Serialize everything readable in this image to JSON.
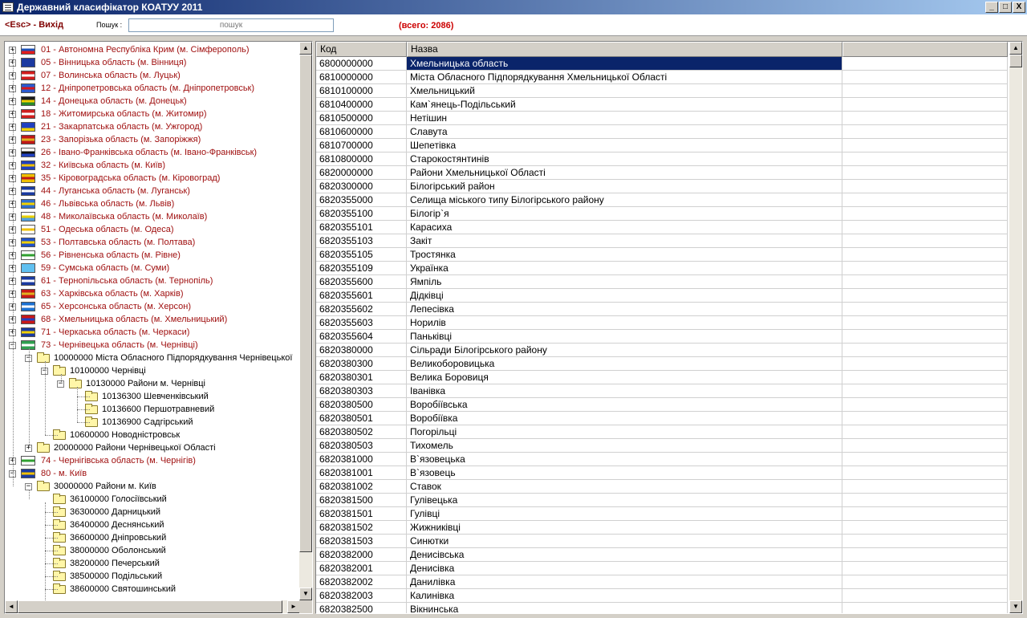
{
  "window": {
    "title": "Державний класифікатор КОАТУУ 2011",
    "btn_min": "_",
    "btn_max": "□",
    "btn_close": "X"
  },
  "toolbar": {
    "esc_key": "<Esc>",
    "esc_label": " - Вихід",
    "search_label": "Пошук :",
    "search_placeholder": "пошук",
    "total": "(всего: 2086)"
  },
  "tree": {
    "regions": [
      {
        "text": "01 - Автономна Республіка Крим (м. Сімферополь)",
        "flag": [
          "#ffffff",
          "#1e4fb4",
          "#e21c1c"
        ]
      },
      {
        "text": "05 - Вінницька область (м. Вінниця)",
        "flag": [
          "#1c3aa0",
          "#1c3aa0",
          "#1c3aa0"
        ]
      },
      {
        "text": "07 - Волинська область (м. Луцьк)",
        "flag": [
          "#d01c1c",
          "#ffffff",
          "#d01c1c"
        ]
      },
      {
        "text": "12 - Дніпропетровська область (м. Дніпропетровськ)",
        "flag": [
          "#2a5ad0",
          "#d81818",
          "#2a5ad0"
        ]
      },
      {
        "text": "14 - Донецька область (м. Донецьк)",
        "flag": [
          "#1a1a1a",
          "#f0d000",
          "#2a8a2a"
        ]
      },
      {
        "text": "18 - Житомирська область (м. Житомир)",
        "flag": [
          "#d02020",
          "#ffffff",
          "#d02020"
        ]
      },
      {
        "text": "21 - Закарпатська область (м. Ужгород)",
        "flag": [
          "#2040c0",
          "#2040c0",
          "#f0d000"
        ]
      },
      {
        "text": "23 - Запорізька область (м. Запоріжжя)",
        "flag": [
          "#c01818",
          "#e0b020",
          "#c01818"
        ]
      },
      {
        "text": "26 - Івано-Франківська область (м. Івано-Франківськ)",
        "flag": [
          "#ffffff",
          "#101010",
          "#2040c0"
        ]
      },
      {
        "text": "32 - Київська область (м. Київ)",
        "flag": [
          "#2040c0",
          "#f0c000",
          "#2040c0"
        ]
      },
      {
        "text": "35 - Кіровоградська область (м. Кіровоград)",
        "flag": [
          "#f0c000",
          "#c01818",
          "#f0c000"
        ]
      },
      {
        "text": "44 - Луганська область (м. Луганськ)",
        "flag": [
          "#1a3aa0",
          "#ffffff",
          "#1a3aa0"
        ]
      },
      {
        "text": "46 - Львівська область (м. Львів)",
        "flag": [
          "#3070d0",
          "#f0d000",
          "#3070d0"
        ]
      },
      {
        "text": "48 - Миколаївська область (м. Миколаїв)",
        "flag": [
          "#ffffff",
          "#e8d000",
          "#50a0e0"
        ]
      },
      {
        "text": "51 - Одеська область (м. Одеса)",
        "flag": [
          "#ffffff",
          "#f0c000",
          "#ffffff"
        ]
      },
      {
        "text": "53 - Полтавська область (м. Полтава)",
        "flag": [
          "#2050c8",
          "#f0d000",
          "#2050c8"
        ]
      },
      {
        "text": "56 - Рівненська область (м. Рівне)",
        "flag": [
          "#ffffff",
          "#30a030",
          "#ffffff"
        ]
      },
      {
        "text": "59 - Сумська область (м. Суми)",
        "flag": [
          "#60c0f0",
          "#60c0f0",
          "#60c0f0"
        ]
      },
      {
        "text": "61 - Тернопільська область (м. Тернопіль)",
        "flag": [
          "#1a3aa0",
          "#ffffff",
          "#1a3aa0"
        ]
      },
      {
        "text": "63 - Харківська область (м. Харків)",
        "flag": [
          "#c81818",
          "#e0b020",
          "#c81818"
        ]
      },
      {
        "text": "65 - Херсонська область (м. Херсон)",
        "flag": [
          "#1c70d0",
          "#ffffff",
          "#1c70d0"
        ]
      },
      {
        "text": "68 - Хмельницька область (м. Хмельницький)",
        "flag": [
          "#c81818",
          "#2040c0",
          "#c81818"
        ]
      },
      {
        "text": "71 - Черкаська область (м. Черкаси)",
        "flag": [
          "#1a3aa0",
          "#f0d000",
          "#1a3aa0"
        ]
      },
      {
        "text": "73 - Чернівецька область (м. Чернівці)",
        "flag": [
          "#30a050",
          "#ffffff",
          "#30a050"
        ]
      }
    ],
    "chernivtsi_children": [
      {
        "text": "10000000 Міста Обласного Підпорядкування Чернівецької"
      },
      {
        "text": "10100000 Чернівці"
      },
      {
        "text": "10130000 Райони м. Чернівці"
      },
      {
        "text": "10136300 Шевченківський"
      },
      {
        "text": "10136600 Першотравневий"
      },
      {
        "text": "10136900 Садгірський"
      },
      {
        "text": "10600000 Новодністровськ"
      },
      {
        "text": "20000000 Райони Чернівецької Області"
      }
    ],
    "region74": {
      "text": "74 - Чернігівська область (м. Чернігів)",
      "flag": [
        "#ffffff",
        "#30a030",
        "#ffffff"
      ]
    },
    "region80": {
      "text": "80 - м. Київ",
      "flag": [
        "#1a3aa0",
        "#f0c000",
        "#1a3aa0"
      ]
    },
    "kyiv_children": [
      {
        "text": "30000000 Райони м. Київ"
      },
      {
        "text": "36100000 Голосіївський"
      },
      {
        "text": "36300000 Дарницький"
      },
      {
        "text": "36400000 Деснянський"
      },
      {
        "text": "36600000 Дніпровський"
      },
      {
        "text": "38000000 Оболонський"
      },
      {
        "text": "38200000 Печерський"
      },
      {
        "text": "38500000 Подільський"
      },
      {
        "text": "38600000 Святошинський"
      }
    ]
  },
  "grid": {
    "col_code": "Код",
    "col_name": "Назва",
    "rows": [
      [
        "6800000000",
        "Хмельницька область"
      ],
      [
        "6810000000",
        "Міста Обласного Підпорядкування Хмельницької Області"
      ],
      [
        "6810100000",
        "Хмельницький"
      ],
      [
        "6810400000",
        "Кам`янець-Подільський"
      ],
      [
        "6810500000",
        "Нетішин"
      ],
      [
        "6810600000",
        "Славута"
      ],
      [
        "6810700000",
        "Шепетівка"
      ],
      [
        "6810800000",
        "Старокостянтинів"
      ],
      [
        "6820000000",
        "Райони Хмельницької Області"
      ],
      [
        "6820300000",
        "Білогірський район"
      ],
      [
        "6820355000",
        "Селища міського типу Білогірського району"
      ],
      [
        "6820355100",
        "Білогір`я"
      ],
      [
        "6820355101",
        "Карасиха"
      ],
      [
        "6820355103",
        "Закіт"
      ],
      [
        "6820355105",
        "Тростянка"
      ],
      [
        "6820355109",
        "Українка"
      ],
      [
        "6820355600",
        "Ямпіль"
      ],
      [
        "6820355601",
        "Дідківці"
      ],
      [
        "6820355602",
        "Лепесівка"
      ],
      [
        "6820355603",
        "Норилів"
      ],
      [
        "6820355604",
        "Паньківці"
      ],
      [
        "6820380000",
        "Сільради Білогірського району"
      ],
      [
        "6820380300",
        "Великоборовицька"
      ],
      [
        "6820380301",
        "Велика Боровиця"
      ],
      [
        "6820380303",
        "Іванівка"
      ],
      [
        "6820380500",
        "Воробіївська"
      ],
      [
        "6820380501",
        "Воробіївка"
      ],
      [
        "6820380502",
        "Погорільці"
      ],
      [
        "6820380503",
        "Тихомель"
      ],
      [
        "6820381000",
        "В`язовецька"
      ],
      [
        "6820381001",
        "В`язовець"
      ],
      [
        "6820381002",
        "Ставок"
      ],
      [
        "6820381500",
        "Гулівецька"
      ],
      [
        "6820381501",
        "Гулівці"
      ],
      [
        "6820381502",
        "Жижниківці"
      ],
      [
        "6820381503",
        "Синютки"
      ],
      [
        "6820382000",
        "Денисівська"
      ],
      [
        "6820382001",
        "Денисівка"
      ],
      [
        "6820382002",
        "Данилівка"
      ],
      [
        "6820382003",
        "Калинівка"
      ],
      [
        "6820382500",
        "Вікнинська"
      ]
    ]
  },
  "scroll": {
    "up": "▲",
    "down": "▼",
    "left": "◄",
    "right": "►"
  }
}
